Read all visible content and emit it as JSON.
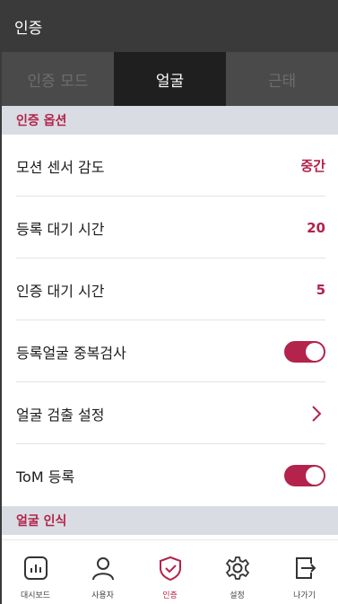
{
  "header": {
    "title": "인증"
  },
  "tabs": [
    {
      "label": "인증 모드",
      "active": false
    },
    {
      "label": "얼굴",
      "active": true
    },
    {
      "label": "근태",
      "active": false
    }
  ],
  "sections": {
    "options": "인증 옵션",
    "recognition": "얼굴 인식"
  },
  "rows": {
    "motion": {
      "label": "모션 센서 감도",
      "value": "중간"
    },
    "register_wait": {
      "label": "등록 대기 시간",
      "value": "20"
    },
    "auth_wait": {
      "label": "인증 대기 시간",
      "value": "5"
    },
    "duplicate_check": {
      "label": "등록얼굴 중복검사",
      "enabled": true
    },
    "detection": {
      "label": "얼굴 검출 설정"
    },
    "tom": {
      "label": "ToM 등록",
      "enabled": true
    }
  },
  "nav": [
    {
      "label": "대시보드",
      "icon": "dashboard-icon",
      "active": false
    },
    {
      "label": "사용자",
      "icon": "user-icon",
      "active": false
    },
    {
      "label": "인증",
      "icon": "shield-check-icon",
      "active": true
    },
    {
      "label": "설정",
      "icon": "gear-icon",
      "active": false
    },
    {
      "label": "나가기",
      "icon": "exit-icon",
      "active": false
    }
  ],
  "colors": {
    "accent": "#b3234b",
    "header_bg": "#3a3a3a",
    "tab_active_bg": "#1f1f1f",
    "section_bg": "#d9dde3"
  }
}
